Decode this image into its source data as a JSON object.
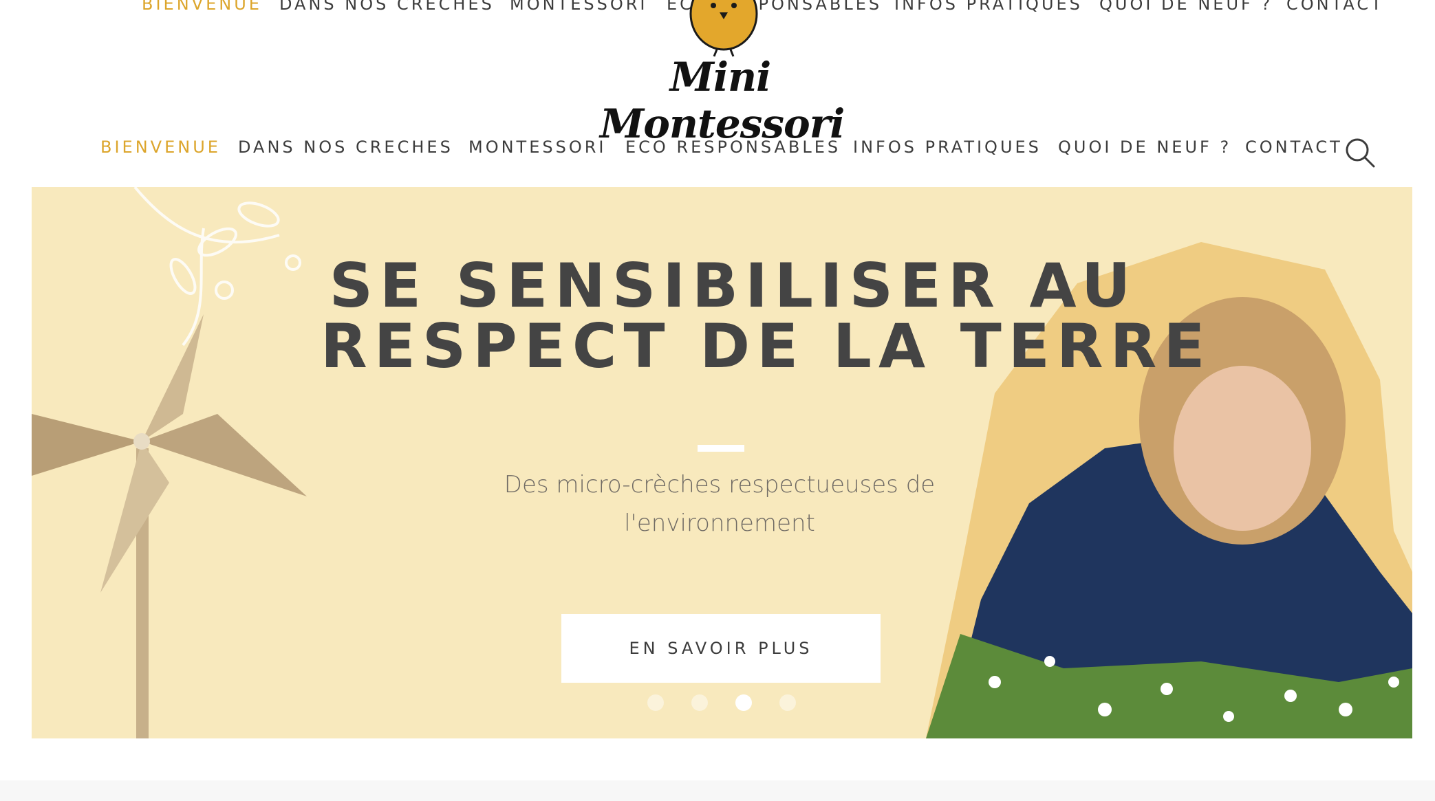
{
  "brand": {
    "name": "Mini Montessori",
    "accent_color": "#dca52b",
    "text_color": "#3c3c3c"
  },
  "nav_top": {
    "items": [
      {
        "label": "BIENVENUE",
        "active": true
      },
      {
        "label": "DANS NOS CRECHES"
      },
      {
        "label": "MONTESSORI"
      },
      {
        "label": "ECO RESPONSABLES"
      },
      {
        "label": "INFOS PRATIQUES"
      },
      {
        "label": "QUOI DE NEUF ?"
      },
      {
        "label": "CONTACT"
      }
    ]
  },
  "nav_main": {
    "items": [
      {
        "label": "BIENVENUE",
        "active": true
      },
      {
        "label": "DANS NOS CRECHES"
      },
      {
        "label": "MONTESSORI"
      },
      {
        "label": "ECO RESPONSABLES"
      },
      {
        "label": "INFOS PRATIQUES"
      },
      {
        "label": "QUOI DE NEUF ?"
      },
      {
        "label": "CONTACT"
      }
    ],
    "search_icon": "search-icon"
  },
  "hero": {
    "title_line1": "SE SENSIBILISER AU",
    "title_line2": "RESPECT DE LA TERRE",
    "subtitle_line1": "Des micro-crèches respectueuses de",
    "subtitle_line2": "l'environnement",
    "cta_label": "EN SAVOIR PLUS",
    "background_color": "#f8e9bd",
    "slides_total": 4,
    "active_slide": 3
  }
}
